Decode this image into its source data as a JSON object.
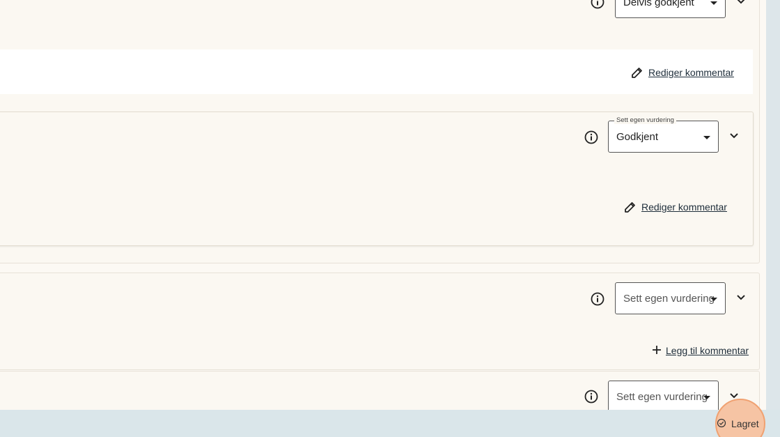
{
  "sections": [
    {
      "assessment": {
        "value": "Delvis godkjent",
        "is_placeholder": false
      },
      "comment_action": "Rediger kommentar"
    },
    {
      "assessment": {
        "legend": "Sett egen vurdering",
        "value": "Godkjent",
        "is_placeholder": false
      },
      "comment_action": "Rediger kommentar"
    },
    {
      "assessment": {
        "value": "Sett egen vurdering",
        "is_placeholder": true
      },
      "comment_action": "Legg til kommentar"
    },
    {
      "assessment": {
        "value": "Sett egen vurdering",
        "is_placeholder": true
      }
    }
  ],
  "save_status": {
    "label": "Lagret",
    "icon": "check-circle-icon"
  },
  "colors": {
    "background": "#fcf9f4",
    "card": "#fbf8f2",
    "bottom_bar": "#dae6ea",
    "saved_highlight": "#f6c4a4"
  }
}
